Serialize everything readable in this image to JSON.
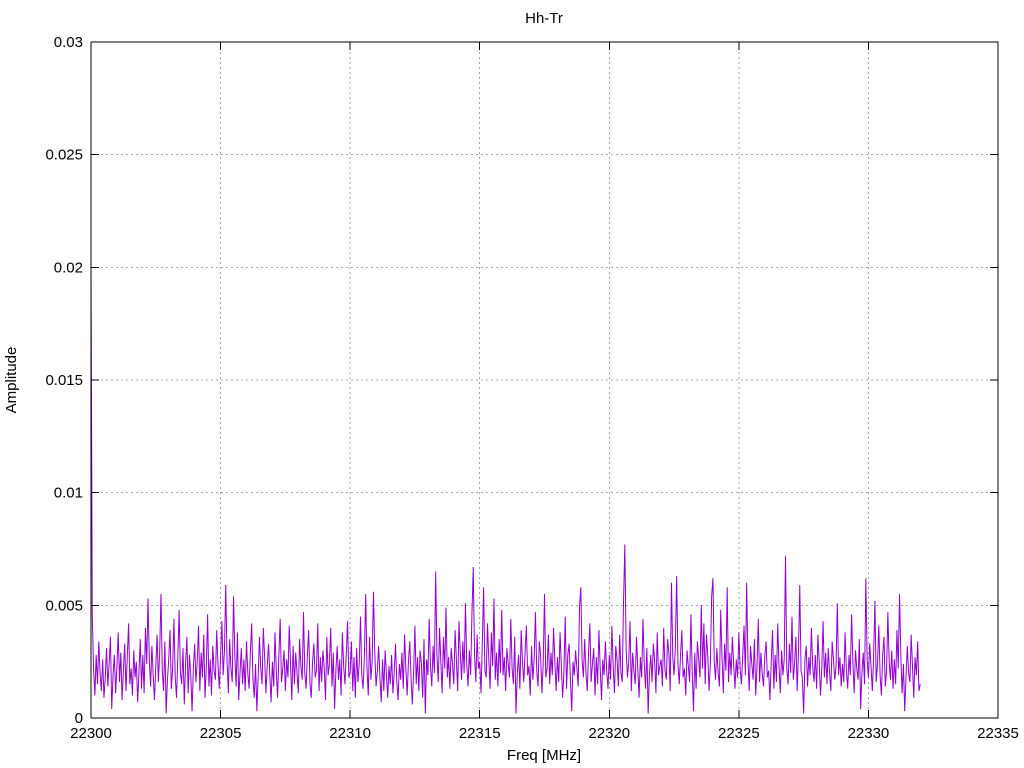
{
  "chart_data": {
    "type": "line",
    "title": "Hh-Tr",
    "xlabel": "Freq [MHz]",
    "ylabel": "Amplitude",
    "xlim": [
      22300,
      22335
    ],
    "ylim": [
      0,
      0.03
    ],
    "x_tick_values": [
      22300,
      22305,
      22310,
      22315,
      22320,
      22325,
      22330,
      22335
    ],
    "x_tick_labels": [
      "22300",
      "22305",
      "22310",
      "22315",
      "22320",
      "22325",
      "22330",
      "22335"
    ],
    "y_tick_values": [
      0,
      0.005,
      0.01,
      0.015,
      0.02,
      0.025,
      0.03
    ],
    "y_tick_labels": [
      "0",
      "0.005",
      "0.01",
      "0.015",
      "0.02",
      "0.025",
      "0.03"
    ],
    "grid": true,
    "legend_position": "none",
    "line_color": "#9400d3",
    "background_color": "#ffffff",
    "series": [
      {
        "name": "Hh-Tr",
        "x_start": 22300.0,
        "x_step": 0.05,
        "amp_scale": 0.001,
        "values": [
          19.8,
          4.5,
          2.2,
          1.0,
          2.8,
          1.5,
          3.4,
          2.0,
          1.2,
          2.6,
          0.9,
          1.8,
          3.1,
          1.4,
          2.4,
          3.6,
          0.4,
          1.9,
          2.8,
          1.1,
          2.3,
          3.8,
          1.6,
          2.9,
          0.8,
          2.1,
          3.3,
          1.2,
          2.7,
          4.2,
          1.5,
          2.2,
          1.0,
          3.0,
          1.8,
          2.5,
          0.7,
          2.0,
          3.5,
          1.3,
          2.8,
          1.1,
          4.0,
          2.4,
          5.3,
          2.6,
          1.4,
          3.2,
          1.9,
          0.8,
          2.3,
          3.7,
          1.6,
          2.9,
          5.5,
          2.1,
          1.2,
          3.4,
          0.2,
          1.7,
          2.6,
          3.9,
          1.3,
          2.2,
          4.4,
          1.8,
          0.9,
          2.7,
          4.8,
          2.0,
          1.5,
          3.1,
          0.6,
          2.4,
          3.6,
          1.1,
          2.8,
          1.9,
          0.3,
          2.2,
          3.3,
          1.6,
          2.5,
          4.1,
          1.2,
          2.9,
          1.8,
          3.7,
          0.9,
          2.3,
          4.6,
          1.4,
          2.6,
          1.0,
          3.2,
          2.1,
          1.7,
          3.9,
          2.4,
          1.3,
          2.7,
          4.3,
          1.9,
          3.0,
          5.9,
          2.5,
          1.1,
          3.5,
          2.2,
          1.6,
          5.4,
          2.8,
          1.4,
          3.8,
          0.8,
          2.0,
          3.1,
          1.5,
          2.6,
          1.2,
          3.4,
          2.0,
          1.3,
          2.9,
          4.2,
          1.7,
          0.9,
          2.4,
          0.3,
          1.8,
          3.6,
          2.2,
          1.5,
          4.0,
          2.7,
          1.1,
          2.3,
          3.3,
          1.9,
          0.7,
          2.5,
          1.4,
          3.8,
          2.1,
          0.9,
          2.8,
          4.4,
          1.6,
          2.2,
          3.0,
          1.2,
          2.6,
          1.8,
          4.1,
          2.4,
          0.8,
          3.2,
          1.5,
          2.9,
          2.0,
          1.1,
          3.5,
          2.3,
          1.7,
          4.7,
          2.0,
          1.3,
          2.8,
          3.9,
          1.5,
          0.9,
          2.5,
          3.3,
          1.8,
          2.1,
          4.2,
          1.2,
          2.7,
          1.6,
          3.0,
          2.2,
          0.8,
          3.6,
          1.9,
          2.4,
          4.0,
          1.4,
          2.9,
          0.4,
          2.1,
          3.2,
          1.7,
          2.6,
          1.0,
          3.8,
          2.3,
          1.5,
          2.8,
          4.3,
          1.8,
          2.0,
          3.4,
          1.2,
          2.7,
          0.9,
          3.1,
          1.6,
          2.4,
          4.5,
          1.9,
          1.3,
          2.8,
          5.5,
          2.2,
          1.0,
          3.6,
          1.7,
          2.5,
          5.6,
          2.9,
          1.4,
          2.1,
          3.2,
          1.8,
          0.7,
          2.6,
          1.2,
          3.0,
          1.9,
          0.9,
          2.3,
          1.5,
          2.8,
          1.1,
          2.0,
          3.3,
          1.6,
          0.8,
          2.4,
          1.7,
          2.9,
          1.3,
          3.7,
          2.2,
          1.0,
          2.5,
          3.4,
          1.8,
          0.6,
          2.1,
          4.1,
          1.5,
          2.7,
          1.2,
          3.0,
          2.4,
          0.9,
          3.5,
          0.2,
          2.6,
          1.9,
          4.4,
          2.3,
          1.4,
          3.2,
          2.0,
          6.5,
          2.8,
          1.6,
          4.0,
          2.5,
          1.1,
          3.6,
          2.2,
          4.9,
          1.8,
          2.7,
          1.3,
          3.1,
          2.4,
          1.5,
          3.9,
          2.6,
          1.2,
          4.3,
          2.9,
          1.7,
          3.4,
          2.0,
          5.1,
          2.4,
          1.4,
          3.0,
          1.9,
          4.6,
          6.7,
          2.8,
          1.6,
          3.7,
          2.2,
          2.5,
          1.1,
          3.3,
          5.8,
          2.1,
          1.8,
          4.2,
          2.6,
          1.3,
          3.8,
          2.3,
          5.3,
          1.7,
          2.9,
          1.4,
          3.5,
          2.0,
          4.8,
          1.9,
          2.7,
          1.2,
          3.1,
          2.4,
          1.8,
          4.4,
          2.2,
          1.5,
          3.6,
          0.2,
          2.0,
          2.8,
          1.3,
          3.9,
          2.5,
          1.6,
          2.9,
          4.1,
          1.9,
          2.3,
          1.0,
          3.2,
          1.7,
          2.6,
          4.7,
          2.1,
          1.4,
          3.4,
          2.8,
          1.1,
          2.4,
          5.5,
          1.8,
          2.2,
          3.7,
          1.5,
          2.9,
          1.9,
          4.0,
          2.5,
          1.2,
          2.7,
          1.6,
          3.8,
          2.3,
          0.9,
          2.1,
          4.5,
          1.3,
          2.8,
          3.3,
          1.7,
          0.3,
          2.5,
          1.9,
          3.0,
          2.2,
          1.4,
          4.9,
          5.8,
          2.6,
          1.8,
          3.5,
          2.0,
          1.2,
          2.9,
          4.2,
          1.6,
          2.4,
          3.1,
          1.0,
          2.7,
          1.5,
          3.9,
          2.2,
          0.8,
          2.6,
          1.9,
          3.4,
          2.1,
          1.3,
          2.8,
          1.7,
          4.1,
          2.3,
          1.1,
          3.2,
          2.6,
          1.4,
          3.7,
          2.0,
          1.6,
          5.2,
          7.7,
          3.0,
          1.8,
          2.5,
          4.3,
          1.2,
          2.9,
          2.1,
          1.5,
          3.6,
          2.2,
          0.9,
          2.7,
          1.8,
          4.4,
          2.4,
          1.3,
          3.1,
          0.2,
          2.0,
          2.8,
          1.6,
          3.3,
          2.5,
          1.1,
          3.8,
          1.9,
          2.3,
          2.6,
          1.4,
          4.0,
          2.1,
          1.7,
          3.5,
          2.9,
          1.2,
          6.0,
          2.7,
          1.9,
          3.2,
          6.3,
          2.4,
          1.5,
          2.8,
          3.9,
          1.8,
          2.2,
          1.0,
          3.0,
          2.3,
          1.6,
          4.6,
          2.0,
          0.3,
          2.9,
          1.3,
          3.4,
          2.6,
          1.8,
          5.0,
          2.2,
          4.2,
          1.5,
          3.7,
          2.8,
          1.2,
          2.4,
          5.4,
          6.2,
          2.5,
          1.7,
          3.1,
          2.0,
          1.4,
          4.8,
          2.7,
          1.1,
          3.3,
          2.1,
          5.8,
          1.6,
          2.9,
          1.9,
          3.6,
          2.4,
          1.3,
          2.6,
          1.8,
          3.8,
          2.2,
          1.5,
          2.8,
          4.1,
          1.9,
          6.0,
          2.6,
          1.2,
          3.2,
          2.4,
          1.7,
          3.5,
          1.0,
          2.3,
          4.4,
          1.6,
          2.9,
          2.0,
          1.4,
          2.7,
          3.4,
          1.8,
          2.1,
          0.8,
          2.5,
          3.9,
          1.3,
          2.8,
          1.6,
          4.2,
          2.3,
          1.1,
          3.0,
          1.9,
          2.6,
          7.2,
          2.2,
          1.5,
          3.3,
          2.0,
          4.5,
          1.7,
          2.4,
          3.6,
          1.2,
          2.9,
          5.9,
          2.1,
          1.8,
          0.2,
          2.6,
          3.2,
          1.4,
          2.7,
          1.9,
          4.0,
          2.3,
          1.6,
          2.8,
          1.3,
          3.7,
          2.5,
          1.0,
          2.2,
          4.3,
          1.8,
          2.9,
          1.5,
          3.1,
          2.0,
          1.2,
          3.4,
          2.6,
          1.7,
          2.3,
          5.1,
          1.9,
          2.7,
          1.4,
          2.4,
          1.6,
          3.8,
          2.1,
          1.3,
          2.8,
          1.9,
          4.6,
          2.5,
          1.1,
          3.0,
          2.2,
          1.7,
          3.5,
          0.4,
          2.0,
          2.9,
          1.5,
          6.2,
          2.6,
          1.8,
          3.3,
          2.3,
          1.2,
          2.7,
          5.2,
          1.6,
          2.4,
          4.1,
          1.9,
          1.0,
          2.8,
          3.6,
          1.4,
          2.1,
          4.7,
          2.5,
          1.7,
          3.0,
          1.3,
          2.6,
          1.5,
          3.9,
          2.2,
          5.5,
          2.8,
          1.1,
          2.4,
          0.3,
          1.8,
          3.2,
          2.0,
          1.6,
          3.7,
          2.3,
          0.9,
          2.7,
          1.9,
          3.4,
          1.2,
          1.5
        ]
      }
    ]
  }
}
